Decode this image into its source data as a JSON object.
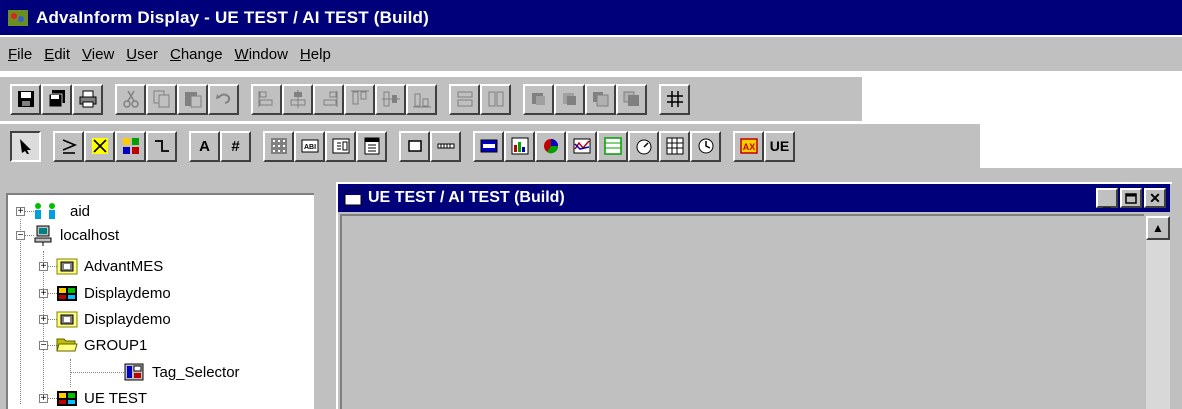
{
  "window": {
    "title": "AdvaInform Display - UE TEST / AI TEST (Build)",
    "icon": "app-logo-icon"
  },
  "menu": {
    "items": [
      {
        "label": "File",
        "icon": "file-menu"
      },
      {
        "label": "Edit",
        "icon": "edit-menu"
      },
      {
        "label": "View",
        "icon": "view-menu"
      },
      {
        "label": "User",
        "icon": "user-menu"
      },
      {
        "label": "Change",
        "icon": "change-menu"
      },
      {
        "label": "Window",
        "icon": "window-menu"
      },
      {
        "label": "Help",
        "icon": "help-menu"
      }
    ]
  },
  "toolbar1": {
    "groups": [
      [
        "save-icon",
        "save-all-icon",
        "print-icon"
      ],
      [
        "cut-icon",
        "copy-icon",
        "paste-icon",
        "undo-icon"
      ],
      [
        "align-left-icon",
        "align-center-icon",
        "align-right-icon",
        "align-top-icon",
        "align-middle-icon",
        "align-bottom-icon"
      ],
      [
        "same-width-icon",
        "same-height-icon"
      ],
      [
        "bring-front-icon",
        "send-back-icon",
        "bring-forward-icon",
        "send-backward-icon"
      ],
      [
        "grid-icon"
      ]
    ]
  },
  "toolbar2": {
    "groups": [
      [
        "pointer-icon"
      ],
      [
        "comparator-ge-icon",
        "comparator-x-icon",
        "colored-blocks-icon",
        "step-icon"
      ],
      [
        "text-icon",
        "number-icon"
      ],
      [
        "dot-matrix-icon",
        "abl-icon",
        "field-icon",
        "field-list-icon"
      ],
      [
        "frame-icon",
        "hatch-icon"
      ],
      [
        "panel-blue-icon",
        "bar-chart-icon",
        "pie-chart-icon",
        "trend-icon",
        "list-icon",
        "gauge-icon",
        "table-icon",
        "clock-icon"
      ],
      [
        "ax-icon",
        "ue-icon"
      ]
    ]
  },
  "tree": {
    "nodes": [
      {
        "label": "aid",
        "icon": "users-icon"
      },
      {
        "label": "localhost",
        "icon": "computer-icon"
      },
      {
        "label": "AdvantMES",
        "icon": "group-icon"
      },
      {
        "label": "Displaydemo",
        "icon": "display-icon"
      },
      {
        "label": "Displaydemo",
        "icon": "group-icon"
      },
      {
        "label": "GROUP1",
        "icon": "open-folder-icon"
      },
      {
        "label": "Tag_Selector",
        "icon": "tag-selector-icon"
      },
      {
        "label": "UE TEST",
        "icon": "display-icon"
      }
    ]
  },
  "child_window": {
    "title": "UE TEST / AI TEST (Build)"
  },
  "colors": {
    "titlebar": "#00007a",
    "face": "#c0c0c0"
  }
}
